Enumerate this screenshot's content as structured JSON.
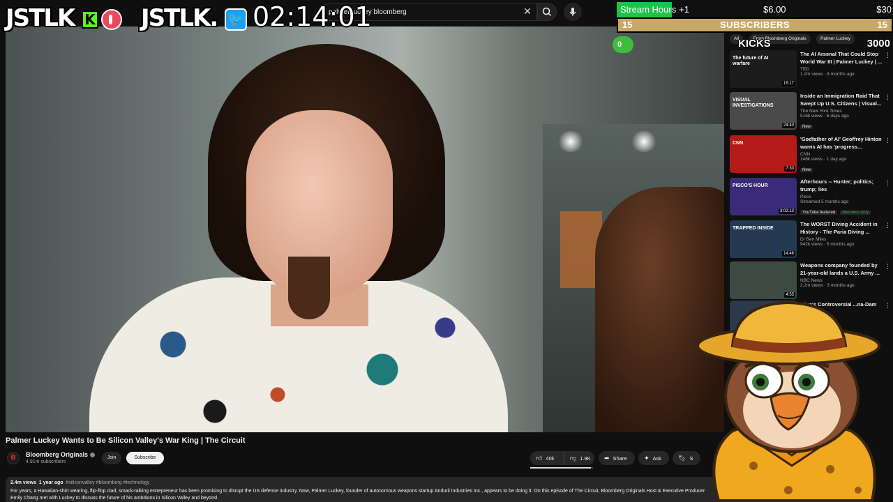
{
  "search": {
    "query": "palmer luckey bloomberg",
    "clear_icon": "close-icon",
    "search_icon": "search-icon",
    "mic_icon": "mic-icon"
  },
  "video": {
    "title": "Palmer Luckey Wants to Be Silicon Valley's War King | The Circuit",
    "channel": {
      "name": "Bloomberg Originals",
      "subscribers": "4.91m subscribers",
      "avatar_letter": "B"
    },
    "join_label": "Join",
    "subscribe_label": "Subscribe",
    "like_count": "40k",
    "dislike_count": "1.9K",
    "share_label": "Share",
    "ask_label": "Ask",
    "save_label": "S",
    "like_ratio": 0.97,
    "description": {
      "views": "2.4m views",
      "age": "1 year ago",
      "tags": "#siliconvalley #bloomberg #technology",
      "text": "For years, a Hawaiian-shirt wearing, flip-flop clad, smack-talking entrepreneur has been promising to disrupt the US defense industry. Now, Palmer Luckey, founder of autonomous weapons startup Anduril Industries Inc., appears to be doing it. On this episode of The Circuit, Bloomberg Originals Host & Executive Producer Emily Chang met with Luckey to discuss the future of his ambitions in Silicon Valley and beyond."
    }
  },
  "recommendations": {
    "chips": [
      "All",
      "From Bloomberg Originals",
      "Palmer Luckey"
    ],
    "items": [
      {
        "title": "The AI Arsenal That Could Stop World War III | Palmer Luckey | ...",
        "channel": "TED",
        "stats": "1.2m views · 8 months ago",
        "duration": "15:17",
        "thumb_text": "The future of AI warfare",
        "thumb_color": "#1c1c1c",
        "badge": ""
      },
      {
        "title": "Inside an Immigration Raid That Swept Up U.S. Citizens | Visual...",
        "channel": "The New York Times",
        "stats": "516k views · 6 days ago",
        "duration": "24:40",
        "thumb_text": "VISUAL INVESTIGATIONS",
        "thumb_color": "#4a4a4a",
        "badge": "New"
      },
      {
        "title": "'Godfather of AI' Geoffrey Hinton warns AI has 'progress...",
        "channel": "CNN",
        "stats": "148k views · 1 day ago",
        "duration": "7:30",
        "thumb_text": "CNN",
        "thumb_color": "#b51a1a",
        "badge": "New"
      },
      {
        "title": "Afterhours -- Hunter; politics; trump; lies",
        "channel": "Pisco",
        "stats": "Streamed 5 months ago",
        "duration": "3:02:13",
        "thumb_text": "PISCO'S HOUR",
        "thumb_color": "#3a2b7a",
        "badge": "YouTube featured",
        "members": "Members only"
      },
      {
        "title": "The WORST Diving Accident in History - The Paria Diving ...",
        "channel": "Dr Ben Miles",
        "stats": "942k views · 5 months ago",
        "duration": "14:46",
        "thumb_text": "TRAPPED INSIDE",
        "thumb_color": "#243a52",
        "badge": ""
      },
      {
        "title": "Weapons company founded by 21-year-old lands a U.S. Army ...",
        "channel": "NBC News",
        "stats": "2.2m views · 3 months ago",
        "duration": "4:55",
        "thumb_text": "",
        "thumb_color": "#3d4a44",
        "badge": ""
      },
      {
        "title": "...ina's Controversial ...na-Dam",
        "channel": "",
        "stats": "",
        "duration": "",
        "thumb_text": "",
        "thumb_color": "#2a3a4a",
        "badge": ""
      }
    ]
  },
  "overlay": {
    "logo_text": "JSTLK",
    "logo_twitter_text": "JSTLK.",
    "kick_badge": "K",
    "twitter_glyph": "🐦",
    "clock": "02:14:01",
    "stream_hours": {
      "label": "Stream Hours",
      "increment": "+1",
      "current": "$6.00",
      "max": "$30",
      "fill_fraction": 0.2
    },
    "subscribers": {
      "left": "15",
      "label": "SUBSCRIBERS",
      "right": "15"
    },
    "kicks": {
      "current": "0",
      "label": "KICKS",
      "max": "3000"
    }
  },
  "colors": {
    "kick_green": "#53fc18",
    "twitter_blue": "#1da1f2",
    "subs_gold": "#c9a867",
    "stream_green": "#1fc24a"
  }
}
